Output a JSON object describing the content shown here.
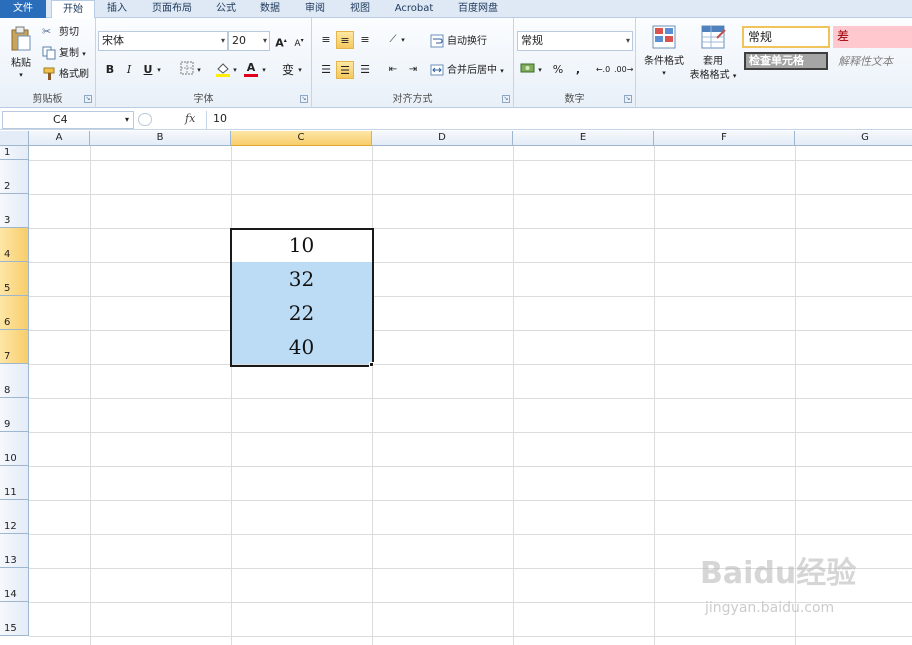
{
  "tabs": [
    "文件",
    "开始",
    "插入",
    "页面布局",
    "公式",
    "数据",
    "审阅",
    "视图",
    "Acrobat",
    "百度网盘"
  ],
  "ribbon": {
    "clipboard": {
      "paste": "粘贴",
      "cut": "剪切",
      "copy": "复制",
      "format_painter": "格式刷",
      "label": "剪贴板"
    },
    "font": {
      "name": "宋体",
      "size": "20",
      "label": "字体",
      "bold": "B",
      "italic": "I",
      "underline": "U",
      "font_color_glyph": "A",
      "phonetic": "变"
    },
    "alignment": {
      "wrap": "自动换行",
      "merge": "合并后居中",
      "label": "对齐方式"
    },
    "number": {
      "format": "常规",
      "percent": "%",
      "comma": ",",
      "label": "数字"
    },
    "styles": {
      "conditional": "条件格式",
      "table_line1": "套用",
      "table_line2": "表格格式",
      "normal": "常规",
      "bad": "差",
      "check_cell": "检查单元格",
      "explanatory": "解释性文本"
    }
  },
  "formula_bar": {
    "name_box": "C4",
    "fx": "fx",
    "value": "10"
  },
  "columns": [
    "A",
    "B",
    "C",
    "D",
    "E",
    "F",
    "G"
  ],
  "rows": [
    "1",
    "2",
    "3",
    "4",
    "5",
    "6",
    "7",
    "8",
    "9",
    "10",
    "11",
    "12",
    "13",
    "14",
    "15"
  ],
  "cells": {
    "C4": "10",
    "C5": "32",
    "C6": "22",
    "C7": "40"
  },
  "watermark": {
    "brand": "Baidu经验",
    "url": "jingyan.baidu.com"
  },
  "colors": {
    "file_tab": "#2a6ebb",
    "selection_fill": "#bcdcf6",
    "header_selected": "#f8cd6b",
    "bad_style": "#ffc7ce"
  }
}
